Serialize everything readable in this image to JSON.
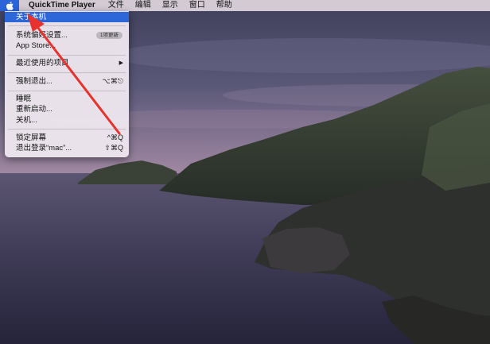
{
  "menubar": {
    "app_name": "QuickTime Player",
    "items": [
      "文件",
      "编辑",
      "显示",
      "窗口",
      "帮助"
    ]
  },
  "apple_menu": {
    "about": "关于本机",
    "system_prefs": "系统偏好设置...",
    "system_prefs_badge": "1项更新",
    "app_store": "App Store...",
    "recent_items": "最近使用的项目",
    "recent_items_arrow": "▶",
    "force_quit": "强制退出...",
    "force_quit_shortcut": "⌥⌘⎋",
    "sleep": "睡眠",
    "restart": "重新启动...",
    "shutdown": "关机...",
    "lock_screen": "锁定屏幕",
    "lock_screen_shortcut": "^⌘Q",
    "logout": "退出登录“mac”...",
    "logout_shortcut": "⇧⌘Q"
  },
  "colors": {
    "selection": "#2d66d8",
    "annotation_arrow": "#e8322d"
  },
  "icons": {
    "apple": "apple-logo-icon"
  }
}
